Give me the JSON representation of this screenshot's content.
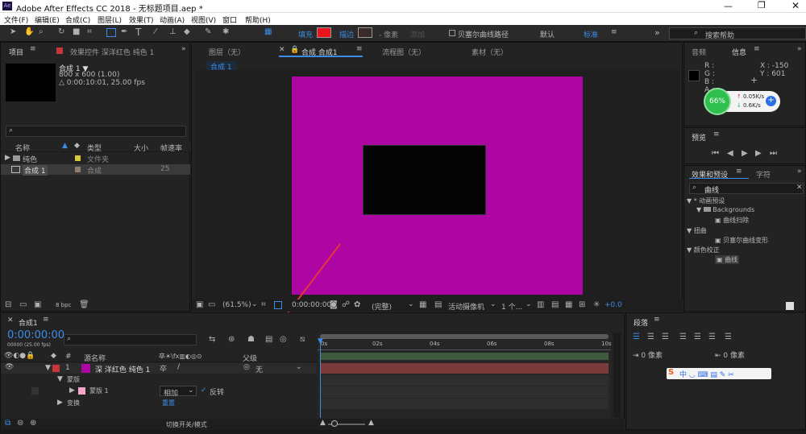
{
  "titlebar": {
    "title": "Adobe After Effects CC 2018 - 无标题项目.aep *",
    "app_icon": "Ae"
  },
  "menu": [
    "文件(F)",
    "编辑(E)",
    "合成(C)",
    "图层(L)",
    "效果(T)",
    "动画(A)",
    "视图(V)",
    "窗口",
    "帮助(H)"
  ],
  "toolbar": {
    "fill_label": "填充",
    "stroke_label": "描边",
    "px_label": "- 像素",
    "add_label": "添加",
    "bezier_label": "贝塞尔曲线路径",
    "default_label": "默认",
    "standard_label": "标准",
    "search_placeholder": "搜索帮助",
    "fill_color": "#e8161c"
  },
  "project_panel": {
    "tab_project": "项目",
    "tab_effects": "效果控件 深洋红色 纯色 1",
    "comp_name": "合成 1 ▼",
    "comp_size": "800 x 600 (1.00)",
    "comp_duration": "△ 0:00:10:01, 25.00 fps",
    "col_name": "名称",
    "col_type": "类型",
    "col_size": "大小",
    "col_fps": "帧速率",
    "items": [
      {
        "name": "纯色",
        "type": "文件夹",
        "fps": ""
      },
      {
        "name": "合成 1",
        "type": "合成",
        "fps": "25"
      }
    ],
    "bpc": "8 bpc"
  },
  "comp_panel": {
    "tab_layer": "图层（无）",
    "tab_comp": "合成 合成1",
    "tab_flow": "流程图（无）",
    "tab_footage": "素材（无）",
    "crumb": "合成 1",
    "bg_color": "#ad06a2",
    "inner_color": "#050505",
    "zoom": "(61.5%)",
    "timecode": "0:00:00:00",
    "quality": "(完整)",
    "camera": "活动摄像机",
    "views": "1 个...",
    "exposure": "+0.0"
  },
  "right_panel": {
    "tab_audio": "音频",
    "tab_info": "信息",
    "rgba": [
      "R :",
      "G :",
      "B :",
      "A :"
    ],
    "x": "X : -150",
    "y": "Y : 601",
    "net_percent": "66%",
    "net_up": "0.05K/s",
    "net_down": "0.6K/s",
    "preview_title": "预览",
    "effects_tab": "效果和预设",
    "char_tab": "字符",
    "effects_search": "曲线",
    "tree": [
      {
        "label": "* 动画预设",
        "indent": 0,
        "arrow": "▼"
      },
      {
        "label": "Backgrounds",
        "indent": 1,
        "arrow": "▼"
      },
      {
        "label": "曲线扫除",
        "indent": 2,
        "arrow": ""
      },
      {
        "label": "扭曲",
        "indent": 0,
        "arrow": "▼"
      },
      {
        "label": "贝塞尔曲线变形",
        "indent": 2,
        "arrow": ""
      },
      {
        "label": "颜色校正",
        "indent": 0,
        "arrow": "▼"
      },
      {
        "label": "曲线",
        "indent": 2,
        "arrow": ""
      }
    ]
  },
  "timeline": {
    "tab": "合成1",
    "timecode": "0:00:00:00",
    "fps_note": "00000 (25.00 fps)",
    "col_source": "源名称",
    "col_parent": "父级",
    "layer_index": "1",
    "layer_name": "深 洋红色 纯色 1",
    "layer_parent": "无",
    "mask_group": "蒙版",
    "mask_name": "蒙版 1",
    "mask_mode": "相加",
    "mask_invert": "反转",
    "transform": "变换",
    "reset": "重置",
    "toggle_label": "切换开关/模式",
    "ticks": [
      "0s",
      "02s",
      "04s",
      "06s",
      "08s",
      "10s"
    ]
  },
  "paragraph_panel": {
    "title": "段落",
    "px0": "0 像素"
  }
}
